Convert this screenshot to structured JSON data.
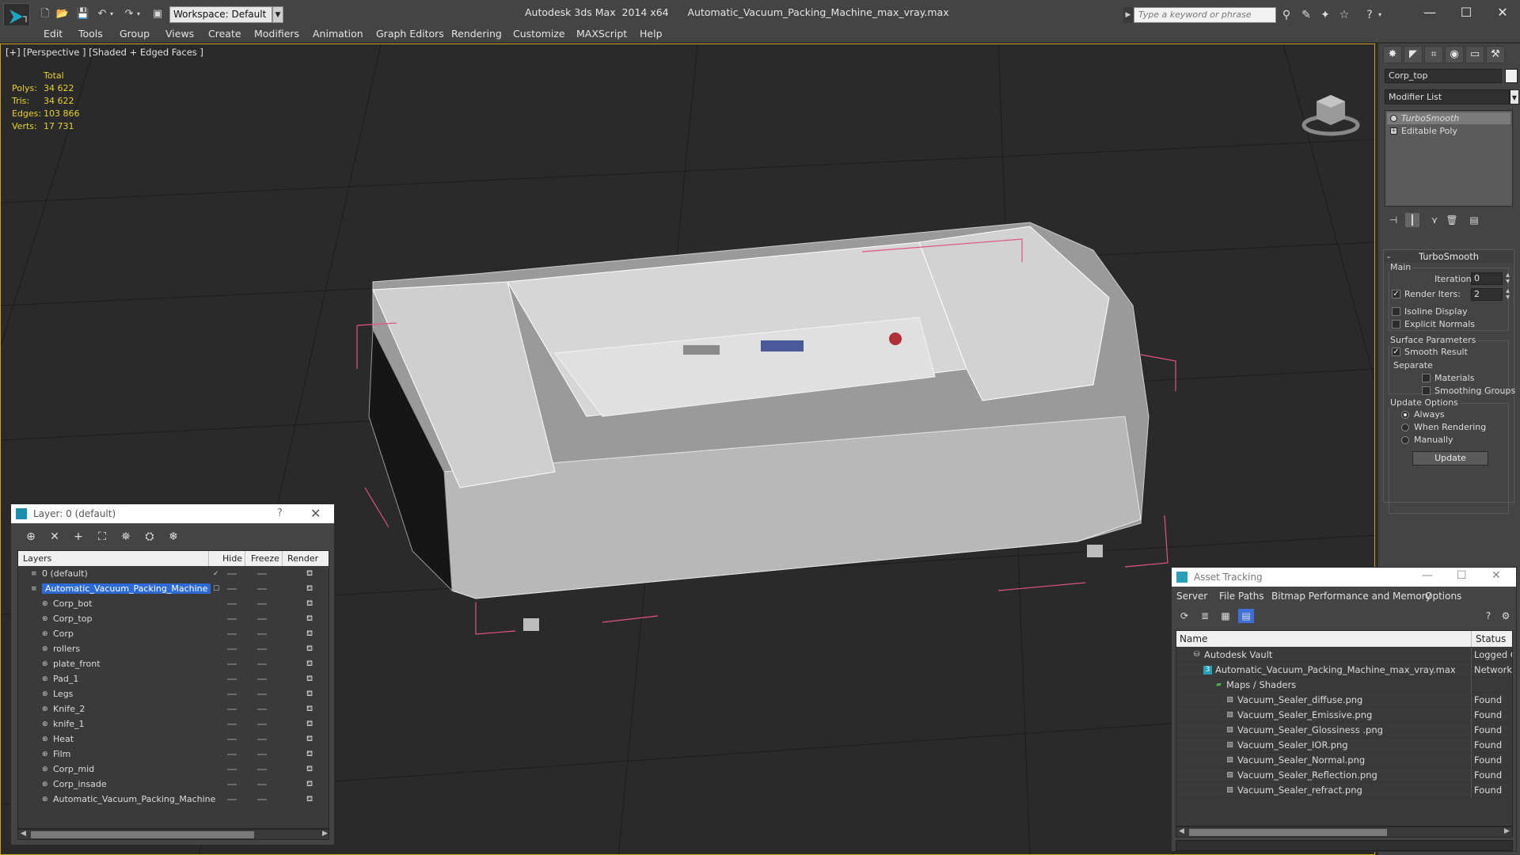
{
  "title_bar": {
    "app_name": "Autodesk 3ds Max  2014 x64",
    "file_name": "Automatic_Vacuum_Packing_Machine_max_vray.max",
    "workspace": "Workspace: Default",
    "search_placeholder": "Type a keyword or phrase"
  },
  "menu": [
    "Edit",
    "Tools",
    "Group",
    "Views",
    "Create",
    "Modifiers",
    "Animation",
    "Graph Editors",
    "Rendering",
    "Customize",
    "MAXScript",
    "Help"
  ],
  "viewport": {
    "label": "[+] [Perspective ] [Shaded + Edged Faces ]",
    "stats": {
      "header": "Total",
      "rows": [
        {
          "key": "Polys:",
          "value": "34 622"
        },
        {
          "key": "Tris:",
          "value": "34 622"
        },
        {
          "key": "Edges:",
          "value": "103 866"
        },
        {
          "key": "Verts:",
          "value": "17 731"
        }
      ]
    }
  },
  "command_panel": {
    "object_name": "Corp_top",
    "modifier_list": "Modifier List",
    "stack": [
      "TurboSmooth",
      "Editable Poly"
    ],
    "turbosmooth": {
      "title": "TurboSmooth",
      "main_group": "Main",
      "iterations_label": "Iterations:",
      "iterations_value": "0",
      "render_iters_label": "Render Iters:",
      "render_iters_value": "2",
      "isoline": "Isoline Display",
      "explicit_normals": "Explicit Normals",
      "surface_group": "Surface Parameters",
      "smooth_result": "Smooth Result",
      "separate": "Separate",
      "materials": "Materials",
      "smoothing_groups": "Smoothing Groups",
      "update_group": "Update Options",
      "always": "Always",
      "when_rendering": "When Rendering",
      "manually": "Manually",
      "update_button": "Update"
    }
  },
  "layer_dialog": {
    "title": "Layer: 0 (default)",
    "help": "?",
    "columns": {
      "layers": "Layers",
      "hide": "Hide",
      "freeze": "Freeze",
      "render": "Render"
    },
    "layers": [
      {
        "name": "0 (default)",
        "level": 0
      },
      {
        "name": "Automatic_Vacuum_Packing_Machine",
        "level": 0
      },
      {
        "name": "Corp_bot",
        "level": 1
      },
      {
        "name": "Corp_top",
        "level": 1
      },
      {
        "name": "Corp",
        "level": 1
      },
      {
        "name": "rollers",
        "level": 1
      },
      {
        "name": "plate_front",
        "level": 1
      },
      {
        "name": "Pad_1",
        "level": 1
      },
      {
        "name": "Legs",
        "level": 1
      },
      {
        "name": "Knife_2",
        "level": 1
      },
      {
        "name": "knife_1",
        "level": 1
      },
      {
        "name": "Heat",
        "level": 1
      },
      {
        "name": "Film",
        "level": 1
      },
      {
        "name": "Corp_mid",
        "level": 1
      },
      {
        "name": "Corp_insade",
        "level": 1
      },
      {
        "name": "Automatic_Vacuum_Packing_Machine",
        "level": 1
      }
    ]
  },
  "asset_dialog": {
    "title": "Asset Tracking",
    "menu": [
      "Server",
      "File",
      "Paths",
      "Bitmap Performance and Memory",
      "Options"
    ],
    "columns": {
      "name": "Name",
      "status": "Status"
    },
    "rows": [
      {
        "name": "Autodesk Vault",
        "status": "Logged Out",
        "level": 0
      },
      {
        "name": "Automatic_Vacuum_Packing_Machine_max_vray.max",
        "status": "Network",
        "level": 1
      },
      {
        "name": "Maps / Shaders",
        "status": "",
        "level": 2
      },
      {
        "name": "Vacuum_Sealer_diffuse.png",
        "status": "Found",
        "level": 3
      },
      {
        "name": "Vacuum_Sealer_Emissive.png",
        "status": "Found",
        "level": 3
      },
      {
        "name": "Vacuum_Sealer_Glossiness .png",
        "status": "Found",
        "level": 3
      },
      {
        "name": "Vacuum_Sealer_IOR.png",
        "status": "Found",
        "level": 3
      },
      {
        "name": "Vacuum_Sealer_Normal.png",
        "status": "Found",
        "level": 3
      },
      {
        "name": "Vacuum_Sealer_Reflection.png",
        "status": "Found",
        "level": 3
      },
      {
        "name": "Vacuum_Sealer_refract.png",
        "status": "Found",
        "level": 3
      }
    ]
  },
  "colors": {
    "ui_bg": "#444444",
    "viewport_bg": "#2a2a2a",
    "viewport_border": "#c8a227",
    "stats_text": "#e8d22a",
    "selection": "#2c6bd6",
    "bbox": "#e0557a"
  }
}
